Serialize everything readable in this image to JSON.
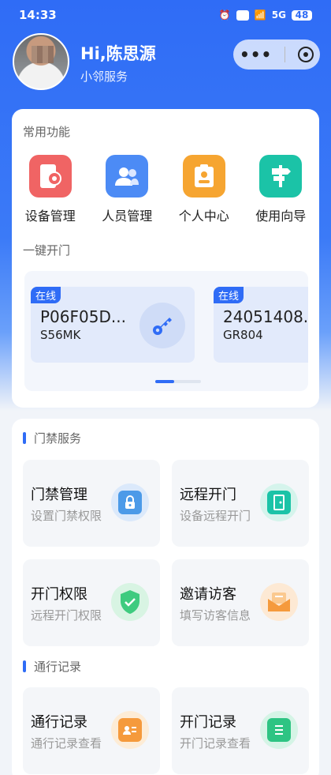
{
  "status": {
    "time": "14:33",
    "battery": "48",
    "network": "5G"
  },
  "header": {
    "greeting": "Hi,陈思源",
    "subtitle": "小邻服务"
  },
  "capsule": {
    "more": "•••"
  },
  "common": {
    "title": "常用功能",
    "items": [
      {
        "label": "设备管理",
        "icon": "door-device-icon",
        "color": "#f06464"
      },
      {
        "label": "人员管理",
        "icon": "people-icon",
        "color": "#4c8bf5"
      },
      {
        "label": "个人中心",
        "icon": "badge-icon",
        "color": "#f6a531"
      },
      {
        "label": "使用向导",
        "icon": "signpost-icon",
        "color": "#1bc3a7"
      }
    ]
  },
  "onekey": {
    "title": "一键开门",
    "doors": [
      {
        "status": "在线",
        "name": "P06F05D...",
        "sub": "S56MK"
      },
      {
        "status": "在线",
        "name": "24051408.",
        "sub": "GR804"
      }
    ]
  },
  "access": {
    "title": "门禁服务",
    "tiles": [
      {
        "title": "门禁管理",
        "sub": "设置门禁权限",
        "icon": "lock-icon"
      },
      {
        "title": "远程开门",
        "sub": "设备远程开门",
        "icon": "door-open-icon"
      },
      {
        "title": "开门权限",
        "sub": "远程开门权限",
        "icon": "shield-check-icon"
      },
      {
        "title": "邀请访客",
        "sub": "填写访客信息",
        "icon": "envelope-icon"
      }
    ]
  },
  "records": {
    "title": "通行记录",
    "tiles": [
      {
        "title": "通行记录",
        "sub": "通行记录查看",
        "icon": "id-card-icon"
      },
      {
        "title": "开门记录",
        "sub": "开门记录查看",
        "icon": "list-doc-icon"
      }
    ]
  }
}
